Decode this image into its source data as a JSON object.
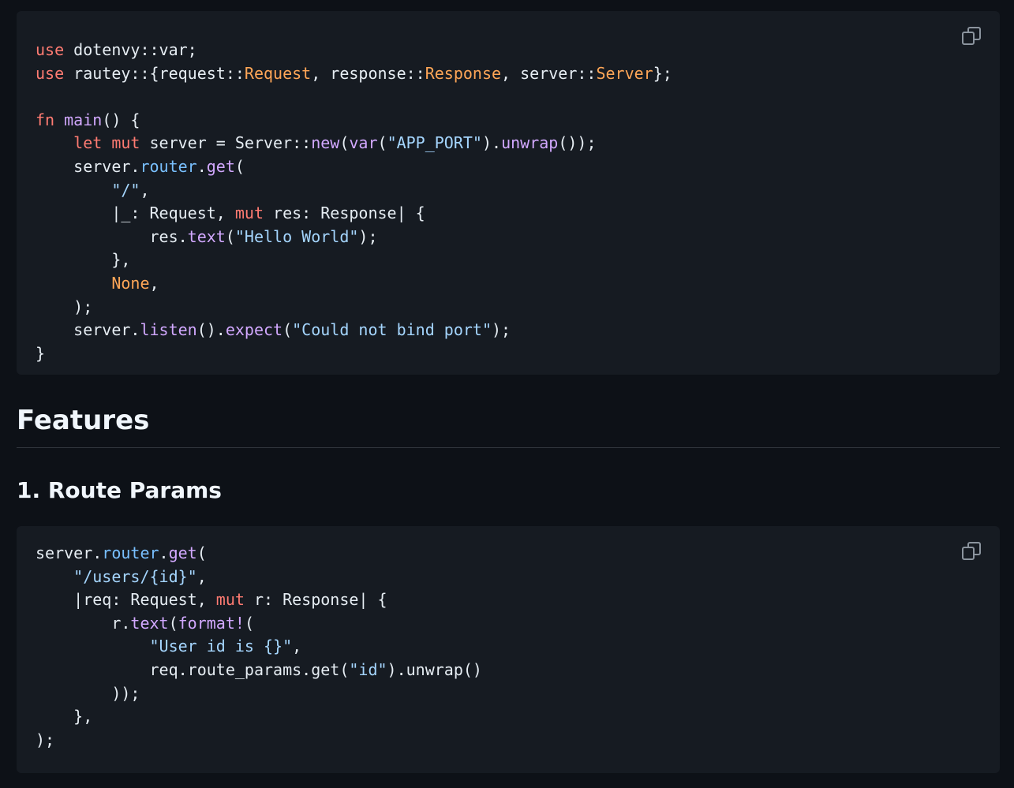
{
  "colors": {
    "page_bg": "#0d1117",
    "code_bg": "#161b22",
    "keyword": "#ff7b72",
    "type": "#ffa657",
    "function": "#d2a8ff",
    "property": "#79c0ff",
    "string": "#a5d6ff",
    "text": "#e6edf3"
  },
  "icons": {
    "copy": "copy-icon"
  },
  "code_block_1": {
    "lines": [
      [
        [
          "kw",
          "use"
        ],
        [
          "plain",
          " dotenvy::var;"
        ]
      ],
      [
        [
          "kw",
          "use"
        ],
        [
          "plain",
          " rautey::{request::"
        ],
        [
          "type",
          "Request"
        ],
        [
          "plain",
          ", response::"
        ],
        [
          "type",
          "Response"
        ],
        [
          "plain",
          ", server::"
        ],
        [
          "type",
          "Server"
        ],
        [
          "plain",
          "};"
        ]
      ],
      [],
      [
        [
          "kw",
          "fn"
        ],
        [
          "plain",
          " "
        ],
        [
          "fn",
          "main"
        ],
        [
          "plain",
          "() {"
        ]
      ],
      [
        [
          "plain",
          "    "
        ],
        [
          "kw",
          "let"
        ],
        [
          "plain",
          " "
        ],
        [
          "kw",
          "mut"
        ],
        [
          "plain",
          " server = Server::"
        ],
        [
          "fn",
          "new"
        ],
        [
          "plain",
          "("
        ],
        [
          "fn",
          "var"
        ],
        [
          "plain",
          "("
        ],
        [
          "str",
          "\"APP_PORT\""
        ],
        [
          "plain",
          ")."
        ],
        [
          "fn",
          "unwrap"
        ],
        [
          "plain",
          "());"
        ]
      ],
      [
        [
          "plain",
          "    server."
        ],
        [
          "prop",
          "router"
        ],
        [
          "plain",
          "."
        ],
        [
          "fn",
          "get"
        ],
        [
          "plain",
          "("
        ]
      ],
      [
        [
          "plain",
          "        "
        ],
        [
          "str",
          "\"/\""
        ],
        [
          "plain",
          ","
        ]
      ],
      [
        [
          "plain",
          "        |_: Request, "
        ],
        [
          "kw",
          "mut"
        ],
        [
          "plain",
          " res: Response| {"
        ]
      ],
      [
        [
          "plain",
          "            res."
        ],
        [
          "fn",
          "text"
        ],
        [
          "plain",
          "("
        ],
        [
          "str",
          "\"Hello World\""
        ],
        [
          "plain",
          ");"
        ]
      ],
      [
        [
          "plain",
          "        },"
        ]
      ],
      [
        [
          "plain",
          "        "
        ],
        [
          "type",
          "None"
        ],
        [
          "plain",
          ","
        ]
      ],
      [
        [
          "plain",
          "    );"
        ]
      ],
      [
        [
          "plain",
          "    server."
        ],
        [
          "fn",
          "listen"
        ],
        [
          "plain",
          "()."
        ],
        [
          "fn",
          "expect"
        ],
        [
          "plain",
          "("
        ],
        [
          "str",
          "\"Could not bind port\""
        ],
        [
          "plain",
          ");"
        ]
      ],
      [
        [
          "plain",
          "}"
        ]
      ]
    ]
  },
  "section": {
    "h2": "Features",
    "h3": "1. Route Params"
  },
  "code_block_2": {
    "lines": [
      [
        [
          "plain",
          "server."
        ],
        [
          "prop",
          "router"
        ],
        [
          "plain",
          "."
        ],
        [
          "fn",
          "get"
        ],
        [
          "plain",
          "("
        ]
      ],
      [
        [
          "plain",
          "    "
        ],
        [
          "str",
          "\"/users/{id}\""
        ],
        [
          "plain",
          ","
        ]
      ],
      [
        [
          "plain",
          "    |req: Request, "
        ],
        [
          "kw",
          "mut"
        ],
        [
          "plain",
          " r: Response| {"
        ]
      ],
      [
        [
          "plain",
          "        r."
        ],
        [
          "fn",
          "text"
        ],
        [
          "plain",
          "("
        ],
        [
          "fn",
          "format!"
        ],
        [
          "plain",
          "("
        ]
      ],
      [
        [
          "plain",
          "            "
        ],
        [
          "str",
          "\"User id is {}\""
        ],
        [
          "plain",
          ","
        ]
      ],
      [
        [
          "plain",
          "            req.route_params.get("
        ],
        [
          "str",
          "\"id\""
        ],
        [
          "plain",
          ").unwrap()"
        ]
      ],
      [
        [
          "plain",
          "        ));"
        ]
      ],
      [
        [
          "plain",
          "    },"
        ]
      ],
      [
        [
          "plain",
          ");"
        ]
      ]
    ]
  }
}
